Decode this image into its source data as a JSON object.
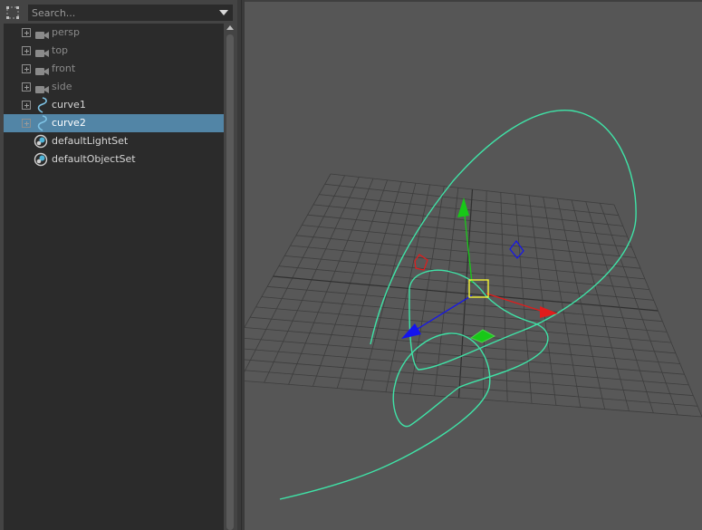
{
  "outliner": {
    "search": {
      "placeholder": "Search...",
      "value": ""
    },
    "items": [
      {
        "label": "persp",
        "kind": "camera",
        "expandable": true,
        "dim": true,
        "selected": false
      },
      {
        "label": "top",
        "kind": "camera",
        "expandable": true,
        "dim": true,
        "selected": false
      },
      {
        "label": "front",
        "kind": "camera",
        "expandable": true,
        "dim": true,
        "selected": false
      },
      {
        "label": "side",
        "kind": "camera",
        "expandable": true,
        "dim": true,
        "selected": false
      },
      {
        "label": "curve1",
        "kind": "curve",
        "expandable": true,
        "dim": false,
        "selected": false
      },
      {
        "label": "curve2",
        "kind": "curve",
        "expandable": true,
        "dim": false,
        "selected": true
      },
      {
        "label": "defaultLightSet",
        "kind": "set",
        "expandable": false,
        "dim": false,
        "selected": false
      },
      {
        "label": "defaultObjectSet",
        "kind": "set",
        "expandable": false,
        "dim": false,
        "selected": false
      }
    ],
    "icons": {
      "filter": "outliner-filter-icon",
      "camera": "camera-icon",
      "curve": "nurbs-curve-icon",
      "set": "object-set-icon",
      "dropdown": "chevron-down-icon"
    }
  },
  "viewport": {
    "grid_color": "#606060",
    "grid_axis_color": "#2f2f2f",
    "curve_color": "#3fe3a7",
    "manipulator": {
      "x_axis_color": "#e11c1c",
      "y_axis_color": "#18c818",
      "z_axis_color": "#1414ee",
      "center_color": "#ffff30"
    }
  },
  "colors": {
    "panel_bg": "#444444",
    "tree_bg": "#2b2b2b",
    "selection": "#5285a6",
    "viewport_bg": "#565656"
  }
}
